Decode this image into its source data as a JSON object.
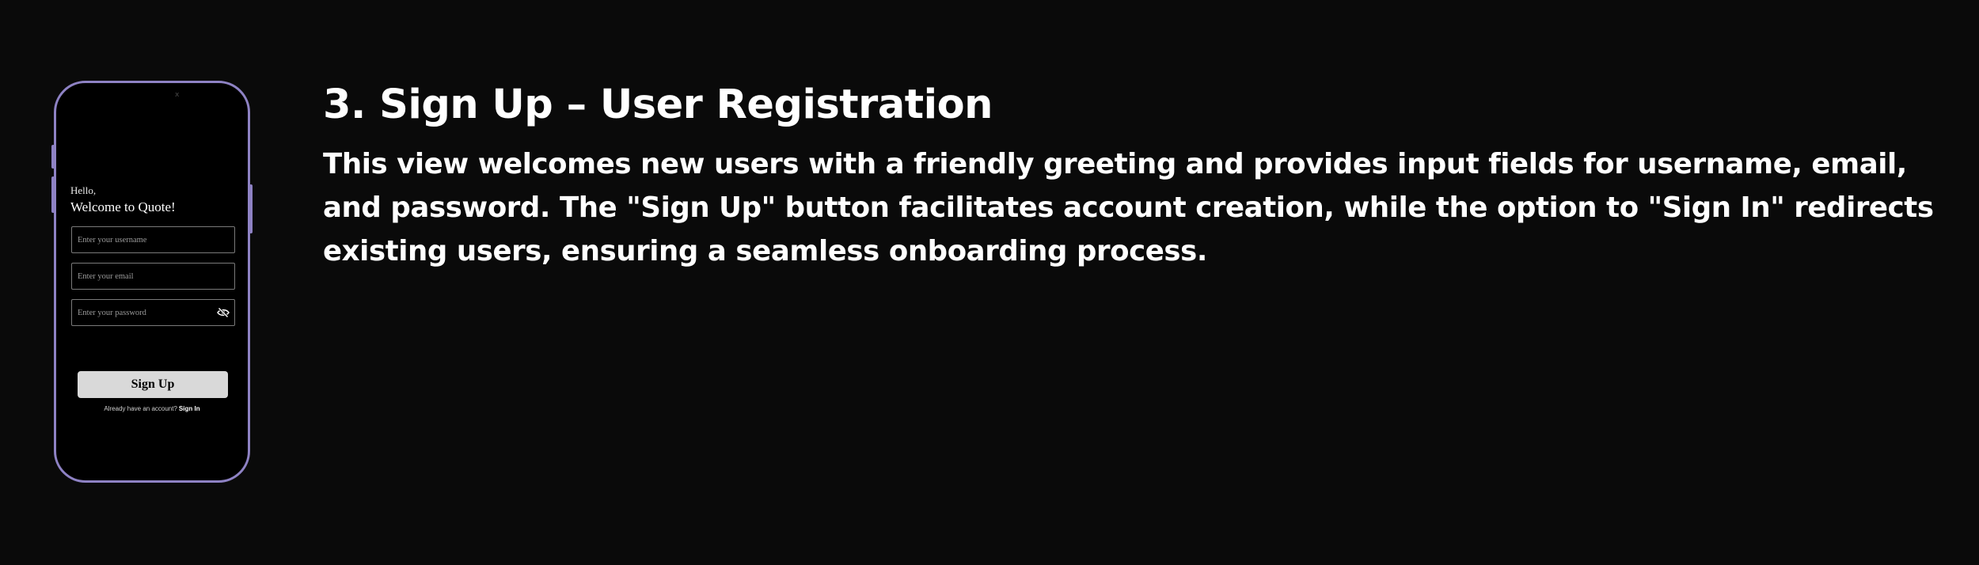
{
  "phone": {
    "notch_mark": "x",
    "greeting": "Hello,",
    "welcome": "Welcome to Quote!",
    "fields": {
      "username_placeholder": "Enter your username",
      "email_placeholder": "Enter your email",
      "password_placeholder": "Enter your password"
    },
    "password_toggle_icon": "eye-slash-icon",
    "signup_label": "Sign Up",
    "already_text": "Already have an account?",
    "signin_label": "Sign In",
    "colors": {
      "frame": "#8e82c4",
      "screen": "#000000",
      "button": "#d9d9d9"
    }
  },
  "section": {
    "title": "3. Sign Up –  User Registration",
    "description": "This view welcomes new users with a friendly greeting and provides input fields for username, email, and password. The \"Sign Up\" button facilitates account creation, while the option to \"Sign In\" redirects existing users, ensuring a seamless onboarding process."
  },
  "colors": {
    "background": "#0a0a0a",
    "text": "#ffffff"
  }
}
